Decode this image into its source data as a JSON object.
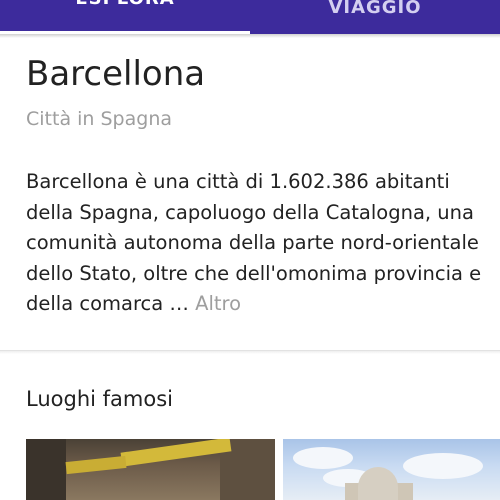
{
  "tabs": [
    {
      "label": "ESPLORA",
      "active": true
    },
    {
      "label": "VIAGGIO",
      "active": false
    }
  ],
  "place": {
    "title": "Barcellona",
    "subtitle": "Città in Spagna",
    "description_lines": [
      "Barcellona è una città di 1.602.386 abitanti",
      "della Spagna, capoluogo della Catalogna, una",
      "comunità autonoma della parte nord-orientale",
      "dello Stato, oltre che dell'omonima provincia e",
      "della comarca …"
    ],
    "more_label": "Altro"
  },
  "famous_places": {
    "title": "Luoghi famosi",
    "images": [
      "street-with-rambla-sign-photo",
      "white-building-with-clouds-photo"
    ]
  },
  "colors": {
    "tab_bar": "#3d2b9c",
    "text_primary": "#222222",
    "text_secondary": "#9e9e9e"
  }
}
